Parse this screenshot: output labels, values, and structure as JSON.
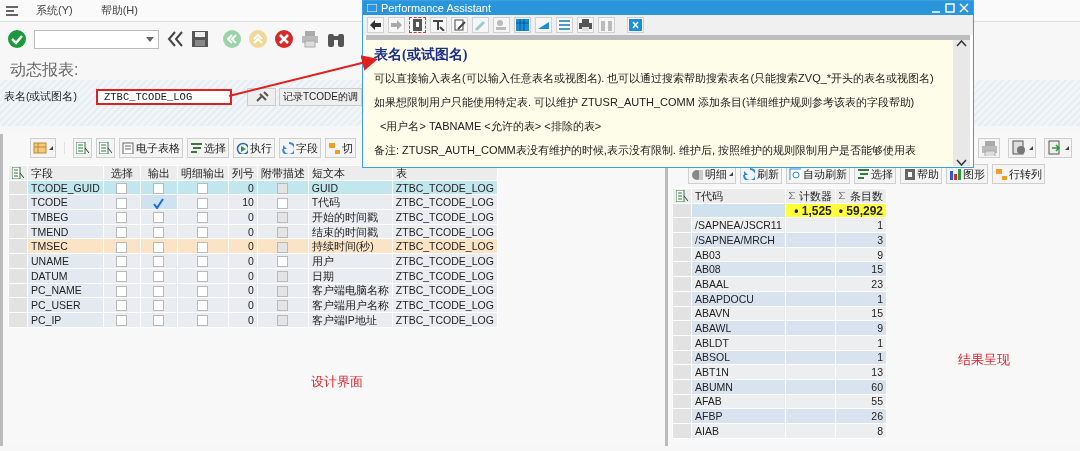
{
  "menu": [
    {
      "label": "系统(Y)"
    },
    {
      "label": "帮助(H)"
    }
  ],
  "page_title": "动态报表:",
  "table_field": {
    "label": "表名(或试图名)",
    "value": "ZTBC_TCODE_LOG",
    "description": "记录TCODE的调"
  },
  "design_panel": {
    "toolbar": [
      {
        "label": "电子表格"
      },
      {
        "label": "选择"
      },
      {
        "label": "执行"
      },
      {
        "label": "字段"
      },
      {
        "label": "切"
      }
    ],
    "columns": [
      "字段",
      "选择",
      "输出",
      "明细输出",
      "列号",
      "附带描述",
      "短文本",
      "表"
    ],
    "rows": [
      {
        "field": "TCODE_GUID",
        "select": false,
        "output": false,
        "detail": false,
        "col_no": "0",
        "desc_disabled": true,
        "short_text": "GUID",
        "table": "ZTBC_TCODE_LOG",
        "selected": true,
        "marked": false
      },
      {
        "field": "TCODE",
        "select": false,
        "output": true,
        "detail": false,
        "col_no": "10",
        "desc_disabled": false,
        "short_text": "T代码",
        "table": "ZTBC_TCODE_LOG",
        "selected": false,
        "marked": false
      },
      {
        "field": "TMBEG",
        "select": false,
        "output": false,
        "detail": false,
        "col_no": "0",
        "desc_disabled": true,
        "short_text": "开始的时间戳",
        "table": "ZTBC_TCODE_LOG",
        "selected": false,
        "marked": false
      },
      {
        "field": "TMEND",
        "select": false,
        "output": false,
        "detail": false,
        "col_no": "0",
        "desc_disabled": true,
        "short_text": "结束的时间戳",
        "table": "ZTBC_TCODE_LOG",
        "selected": false,
        "marked": false
      },
      {
        "field": "TMSEC",
        "select": false,
        "output": false,
        "detail": false,
        "col_no": "0",
        "desc_disabled": true,
        "short_text": "持续时间(秒)",
        "table": "ZTBC_TCODE_LOG",
        "selected": false,
        "marked": true
      },
      {
        "field": "UNAME",
        "select": false,
        "output": false,
        "detail": false,
        "col_no": "0",
        "desc_disabled": false,
        "short_text": "用户",
        "table": "ZTBC_TCODE_LOG",
        "selected": false,
        "marked": false
      },
      {
        "field": "DATUM",
        "select": false,
        "output": false,
        "detail": false,
        "col_no": "0",
        "desc_disabled": true,
        "short_text": "日期",
        "table": "ZTBC_TCODE_LOG",
        "selected": false,
        "marked": false
      },
      {
        "field": "PC_NAME",
        "select": false,
        "output": false,
        "detail": false,
        "col_no": "0",
        "desc_disabled": true,
        "short_text": "客户端电脑名称",
        "table": "ZTBC_TCODE_LOG",
        "selected": false,
        "marked": false
      },
      {
        "field": "PC_USER",
        "select": false,
        "output": false,
        "detail": false,
        "col_no": "0",
        "desc_disabled": true,
        "short_text": "客户端用户名称",
        "table": "ZTBC_TCODE_LOG",
        "selected": false,
        "marked": false
      },
      {
        "field": "PC_IP",
        "select": false,
        "output": false,
        "detail": false,
        "col_no": "0",
        "desc_disabled": true,
        "short_text": "客户端IP地址",
        "table": "ZTBC_TCODE_LOG",
        "selected": false,
        "marked": false
      }
    ],
    "caption": "设计界面"
  },
  "result_panel": {
    "toolbar": [
      {
        "label": "明细",
        "dropdown": true
      },
      {
        "label": "刷新",
        "dropdown": false
      },
      {
        "label": "自动刷新",
        "dropdown": false
      },
      {
        "label": "选择",
        "dropdown": false
      },
      {
        "label": "帮助",
        "dropdown": false
      },
      {
        "label": "图形",
        "dropdown": false
      },
      {
        "label": "行转列",
        "dropdown": false
      }
    ],
    "columns": [
      "T代码",
      "计数器",
      "条目数"
    ],
    "totals": [
      "• 1,525",
      "• 59,292"
    ],
    "rows": [
      {
        "code": "/SAPNEA/JSCR11",
        "count": "1"
      },
      {
        "code": "/SAPNEA/MRCH",
        "count": "3"
      },
      {
        "code": "AB03",
        "count": "9"
      },
      {
        "code": "AB08",
        "count": "15"
      },
      {
        "code": "ABAAL",
        "count": "23"
      },
      {
        "code": "ABAPDOCU",
        "count": "1"
      },
      {
        "code": "ABAVN",
        "count": "15"
      },
      {
        "code": "ABAWL",
        "count": "9"
      },
      {
        "code": "ABLDT",
        "count": "1"
      },
      {
        "code": "ABSOL",
        "count": "1"
      },
      {
        "code": "ABT1N",
        "count": "13"
      },
      {
        "code": "ABUMN",
        "count": "60"
      },
      {
        "code": "AFAB",
        "count": "55"
      },
      {
        "code": "AFBP",
        "count": "26"
      },
      {
        "code": "AIAB",
        "count": "8"
      }
    ],
    "caption": "结果呈现"
  },
  "assistant": {
    "title": "Performance Assistant",
    "heading": "表名(或试图名)",
    "paragraphs": [
      "可以直接输入表名(可以输入任意表名或视图名). 也可以通过搜索帮助搜索表名(只能搜索ZVQ_*开头的表名或视图名)",
      "如果想限制用户只能使用特定表. 可以维护 ZTUSR_AUTH_COMM 添加条目(详细维护规则参考该表的字段帮助)",
      "<用户名> TABNAME <允许的表> <排除的表>",
      "备注: ZTUSR_AUTH_COMM表没有维护的时候,表示没有限制. 维护后, 按照维护的规则限制用户是否能够使用表"
    ]
  }
}
